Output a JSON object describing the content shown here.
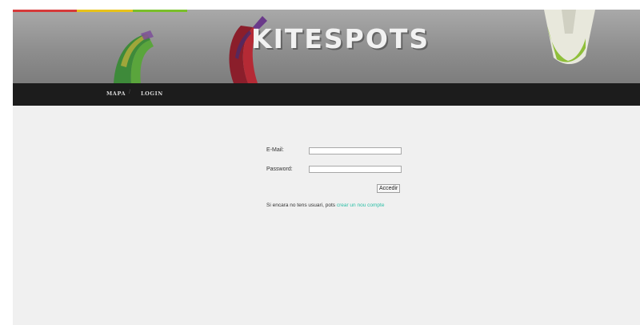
{
  "header": {
    "logo_text": "KITESPOTS",
    "underline_colors": [
      "#d63a3a",
      "#e8c21a",
      "#7abf2a"
    ]
  },
  "nav": {
    "items": [
      {
        "label": "MAPA"
      },
      {
        "label": "LOGIN"
      }
    ],
    "separator": "/"
  },
  "login_form": {
    "email_label": "E-Mail:",
    "email_value": "",
    "password_label": "Password:",
    "password_value": "",
    "submit_label": "Accedir"
  },
  "signup": {
    "prefix": "Si encara no tens usuari, pots ",
    "link_text": "crear un nou compte",
    "link_color": "#2bbfa6"
  }
}
